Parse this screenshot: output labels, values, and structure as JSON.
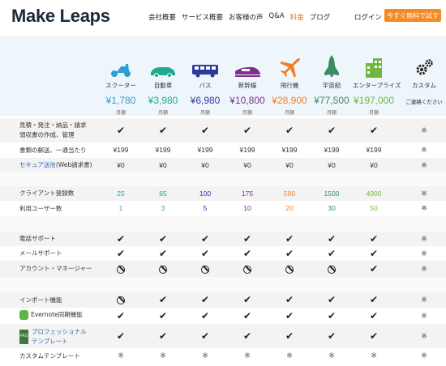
{
  "header": {
    "logo": "Make Leaps",
    "nav": [
      "会社概要",
      "サービス概要",
      "お客様の声",
      "Q&A",
      "料金",
      "ブログ"
    ],
    "nav_active": "料金",
    "login": "ログイン",
    "trial_button": "今すぐ無料で試す"
  },
  "plans": [
    {
      "name": "スクーター",
      "price": "¥1,780",
      "period": "月額",
      "color": "#2a9fd6",
      "icon": "scooter-icon"
    },
    {
      "name": "自動車",
      "price": "¥3,980",
      "period": "月額",
      "color": "#21a88f",
      "icon": "car-icon"
    },
    {
      "name": "バス",
      "price": "¥6,980",
      "period": "月額",
      "color": "#2e3b9c",
      "icon": "bus-icon"
    },
    {
      "name": "新幹線",
      "price": "¥10,800",
      "period": "月額",
      "color": "#7b2f8e",
      "icon": "bullet-train-icon"
    },
    {
      "name": "飛行機",
      "price": "¥28,900",
      "period": "月額",
      "color": "#f07f2c",
      "icon": "airplane-icon"
    },
    {
      "name": "宇宙船",
      "price": "¥77,500",
      "period": "月額",
      "color": "#3d8a64",
      "icon": "space-shuttle-icon"
    },
    {
      "name": "エンタープライズ",
      "price": "¥197,000",
      "period": "月額",
      "color": "#6fb73f",
      "icon": "building-icon"
    },
    {
      "name": "カスタム",
      "price": "ご連絡ください",
      "period": "",
      "color": "#222222",
      "icon": "gears-icon"
    }
  ],
  "rows": [
    {
      "label": "見積・発注・納品・請求\n領収書の作成、管理",
      "cells": [
        "check",
        "check",
        "check",
        "check",
        "check",
        "check",
        "check",
        "kome"
      ]
    },
    {
      "label": "書類の郵送、一通当たり",
      "cells": [
        "¥199",
        "¥199",
        "¥199",
        "¥199",
        "¥199",
        "¥199",
        "¥199",
        "kome"
      ]
    },
    {
      "label": "セキュア送信(Web請求書)",
      "link": "セキュア送信",
      "rest": "(Web請求書)",
      "cells": [
        "¥0",
        "¥0",
        "¥0",
        "¥0",
        "¥0",
        "¥0",
        "¥0",
        "kome"
      ]
    },
    {
      "label": "クライアント登録数",
      "cells": [
        "25",
        "65",
        "100",
        "175",
        "500",
        "1500",
        "4000",
        "kome"
      ]
    },
    {
      "label": "利用ユーザー数",
      "cells": [
        "1",
        "3",
        "5",
        "10",
        "20",
        "30",
        "50",
        "kome"
      ]
    },
    {
      "label": "電話サポート",
      "cells": [
        "check",
        "check",
        "check",
        "check",
        "check",
        "check",
        "check",
        "kome"
      ]
    },
    {
      "label": "メールサポート",
      "cells": [
        "check",
        "check",
        "check",
        "check",
        "check",
        "check",
        "check",
        "kome"
      ]
    },
    {
      "label": "アカウント・マネージャー",
      "cells": [
        "ban",
        "ban",
        "ban",
        "ban",
        "ban",
        "ban",
        "check",
        "kome"
      ]
    },
    {
      "label": "インポート機能",
      "cells": [
        "ban",
        "check",
        "check",
        "check",
        "check",
        "check",
        "check",
        "kome"
      ]
    },
    {
      "label": "Evernote同期機能",
      "cells": [
        "check",
        "check",
        "check",
        "check",
        "check",
        "check",
        "check",
        "kome"
      ]
    },
    {
      "label": "プロフェッショナル\nテンプレート",
      "cells": [
        "check",
        "check",
        "check",
        "check",
        "check",
        "check",
        "check",
        "kome"
      ]
    },
    {
      "label": "カスタムテンプレート",
      "cells": [
        "kome",
        "kome",
        "kome",
        "kome",
        "kome",
        "kome",
        "kome",
        "kome"
      ]
    }
  ],
  "symbols": {
    "check": "✔",
    "kome": "※"
  }
}
